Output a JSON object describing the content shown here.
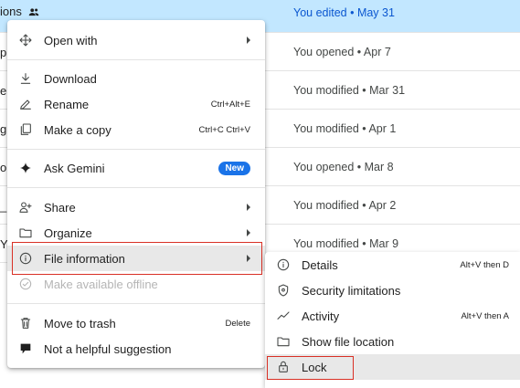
{
  "file_list": {
    "rows": [
      {
        "name_fragment": "ions",
        "meta": "You edited • May 31",
        "selected": true
      },
      {
        "name_fragment": "p",
        "meta": "You opened • Apr 7"
      },
      {
        "name_fragment": "e",
        "meta": "You modified • Mar 31"
      },
      {
        "name_fragment": "g",
        "meta": "You modified • Apr 1"
      },
      {
        "name_fragment": "o",
        "meta": "You opened • Mar 8"
      },
      {
        "name_fragment": "_",
        "meta": "You modified • Apr 2"
      },
      {
        "name_fragment": "Y",
        "meta": "You modified • Mar 9"
      }
    ]
  },
  "context_menu": {
    "items": [
      {
        "label": "Open with"
      },
      {
        "label": "Download"
      },
      {
        "label": "Rename",
        "shortcut": "Ctrl+Alt+E"
      },
      {
        "label": "Make a copy",
        "shortcut": "Ctrl+C Ctrl+V"
      },
      {
        "label": "Ask Gemini",
        "badge": "New"
      },
      {
        "label": "Share"
      },
      {
        "label": "Organize"
      },
      {
        "label": "File information"
      },
      {
        "label": "Make available offline"
      },
      {
        "label": "Move to trash",
        "shortcut": "Delete"
      },
      {
        "label": "Not a helpful suggestion"
      }
    ]
  },
  "file_info_submenu": {
    "items": [
      {
        "label": "Details",
        "shortcut": "Alt+V then D"
      },
      {
        "label": "Security limitations"
      },
      {
        "label": "Activity",
        "shortcut": "Alt+V then A"
      },
      {
        "label": "Show file location"
      },
      {
        "label": "Lock"
      }
    ]
  },
  "colors": {
    "selected_row": "#c2e7ff",
    "accent": "#1a73e8",
    "highlight_box": "#d93025",
    "hover": "#e8e8e8"
  }
}
